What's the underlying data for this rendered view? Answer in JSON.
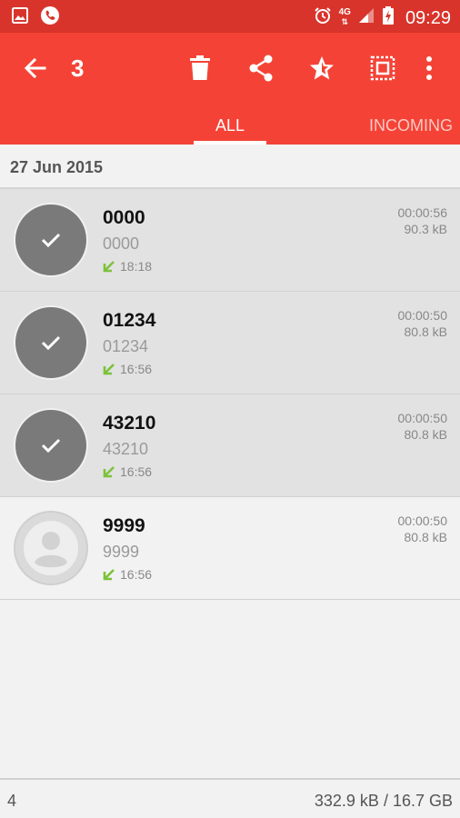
{
  "status_bar": {
    "time": "09:29",
    "network": "4G",
    "left_icons": [
      "gallery-icon",
      "call-icon"
    ],
    "right_icons": [
      "alarm-icon",
      "signal-icon",
      "battery-charging-icon"
    ]
  },
  "app_bar": {
    "selected_count": "3",
    "actions": [
      "delete-icon",
      "share-icon",
      "favorite-icon",
      "select-all-icon",
      "more-vert-icon"
    ],
    "color": "#f44336"
  },
  "tabs": [
    {
      "label": "ALL",
      "active": true
    },
    {
      "label": "INCOMING",
      "active": false
    }
  ],
  "date_header": "27 Jun 2015",
  "recordings": [
    {
      "name": "0000",
      "number": "0000",
      "time": "18:18",
      "duration": "00:00:56",
      "size": "90.3 kB",
      "selected": true
    },
    {
      "name": "01234",
      "number": "01234",
      "time": "16:56",
      "duration": "00:00:50",
      "size": "80.8 kB",
      "selected": true
    },
    {
      "name": "43210",
      "number": "43210",
      "time": "16:56",
      "duration": "00:00:50",
      "size": "80.8 kB",
      "selected": true
    },
    {
      "name": "9999",
      "number": "9999",
      "time": "16:56",
      "duration": "00:00:50",
      "size": "80.8 kB",
      "selected": false
    }
  ],
  "footer": {
    "count": "4",
    "storage": "332.9 kB / 16.7 GB"
  },
  "colors": {
    "status_bar": "#d8342b",
    "app_bar": "#f44336",
    "incoming_arrow": "#7cc23a",
    "selected_avatar": "#7a7a7a"
  }
}
